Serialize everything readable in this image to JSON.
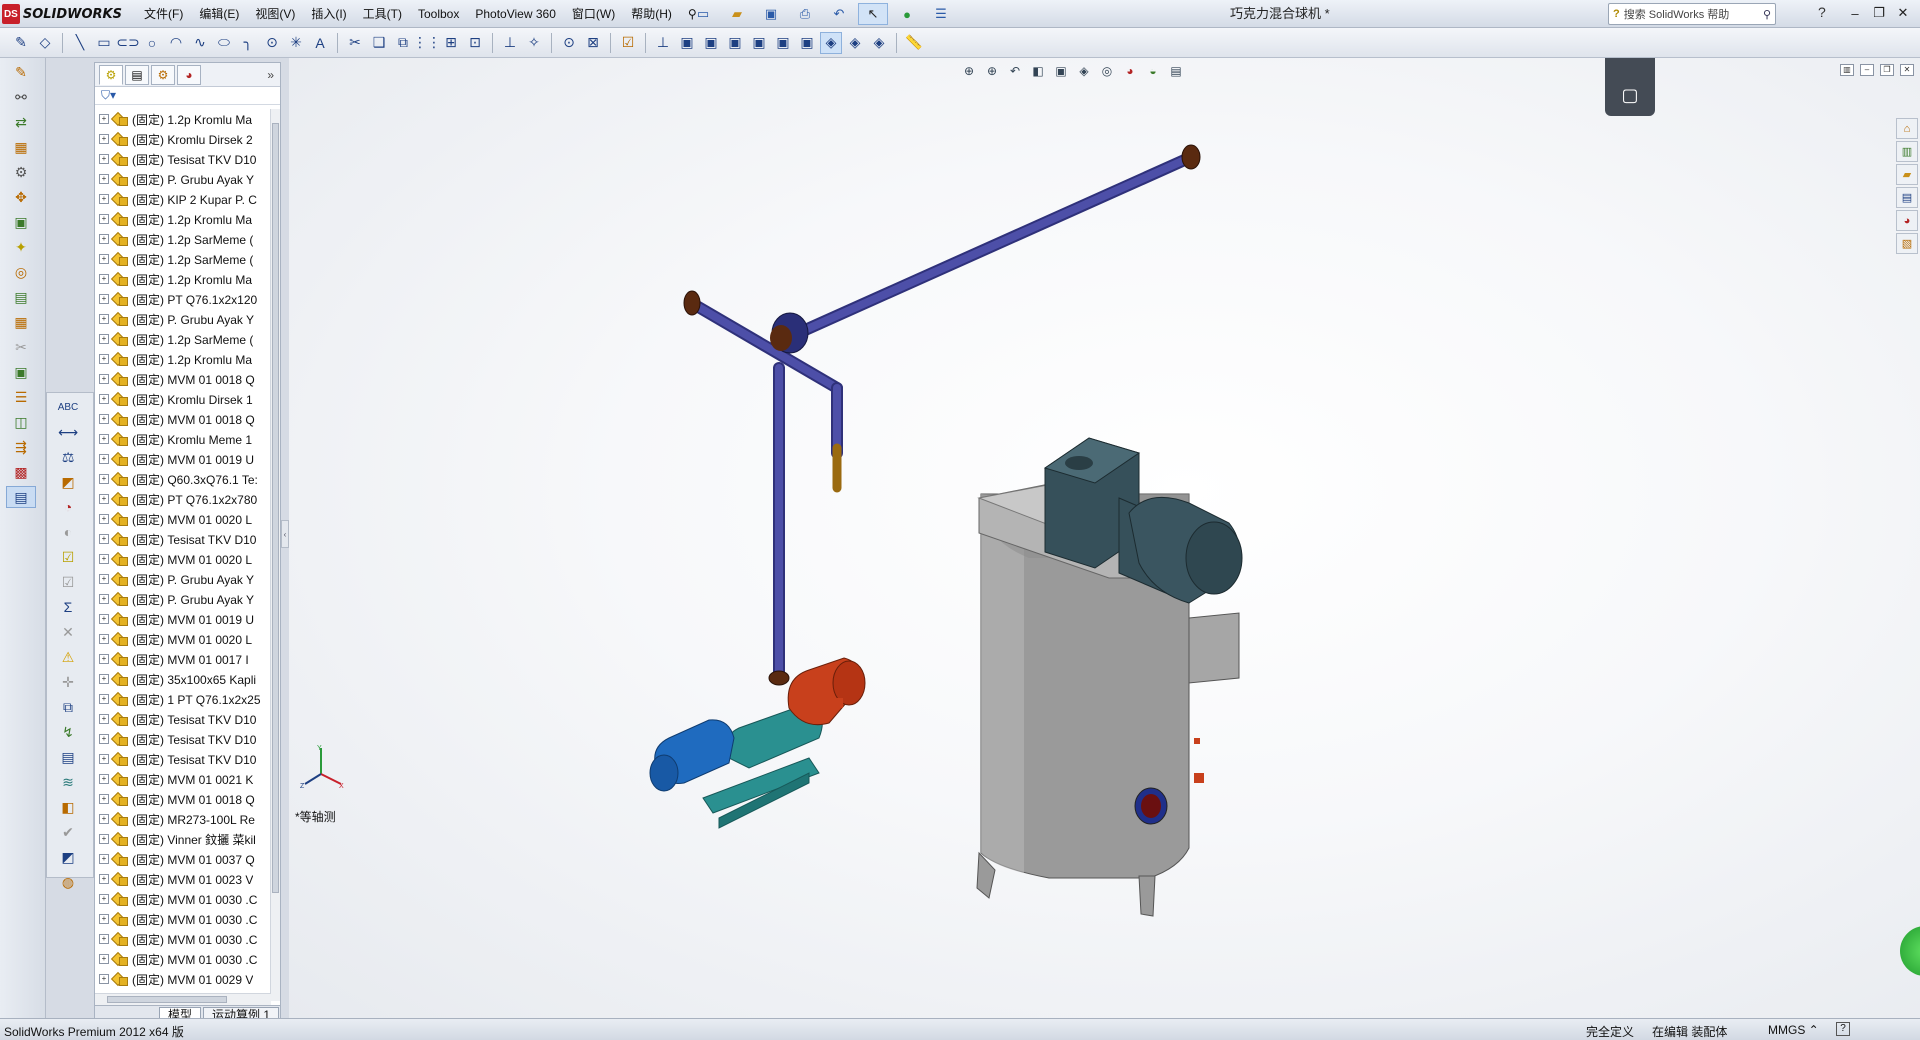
{
  "app": {
    "logo_ds": "DS",
    "logo_text": "SOLIDWORKS",
    "document_title": "巧克力混合球机 *",
    "search_placeholder": "搜索 SolidWorks 帮助"
  },
  "menu": [
    "文件(F)",
    "编辑(E)",
    "视图(V)",
    "插入(I)",
    "工具(T)",
    "Toolbox",
    "PhotoView 360",
    "窗口(W)",
    "帮助(H)"
  ],
  "tree": {
    "items": [
      "(固定) 1.2p Kromlu  Ma",
      "(固定) Kromlu  Dirsek 2",
      "(固定) Tesisat TKV D10",
      "(固定) P. Grubu Ayak Y",
      "(固定) KIP 2 Kupar P. C",
      "(固定) 1.2p Kromlu  Ma",
      "(固定) 1.2p SarMeme (",
      "(固定) 1.2p SarMeme (",
      "(固定) 1.2p Kromlu  Ma",
      "(固定) PT Q76.1x2x120",
      "(固定) P. Grubu Ayak Y",
      "(固定) 1.2p SarMeme (",
      "(固定) 1.2p Kromlu  Ma",
      "(固定) MVM 01 0018 Q",
      "(固定) Kromlu  Dirsek 1",
      "(固定) MVM 01 0018 Q",
      "(固定) Kromlu  Meme 1",
      "(固定) MVM 01 0019 U",
      "(固定) Q60.3xQ76.1 Te:",
      "(固定) PT Q76.1x2x780",
      "(固定) MVM 01 0020  L",
      "(固定) Tesisat TKV D10",
      "(固定) MVM 01 0020  L",
      "(固定) P. Grubu Ayak Y",
      "(固定) P. Grubu Ayak Y",
      "(固定) MVM 01 0019 U",
      "(固定) MVM 01 0020  L",
      "(固定) MVM 01 0017  I",
      "(固定) 35x100x65 Kapli",
      "(固定) 1 PT Q76.1x2x25",
      "(固定) Tesisat TKV D10",
      "(固定) Tesisat TKV D10",
      "(固定) Tesisat TKV D10",
      "(固定) MVM 01 0021 K",
      "(固定) MVM 01 0018 Q",
      "(固定) MR273-100L Re",
      "(固定) Vinner 鈫攦 菜kil",
      "(固定) MVM 01 0037 Q",
      "(固定) MVM 01 0023 V",
      "(固定) MVM 01 0030 .C",
      "(固定) MVM 01 0030 .C",
      "(固定) MVM 01 0030 .C",
      "(固定) MVM 01 0030 .C",
      "(固定) MVM 01 0029 V"
    ],
    "tabs": [
      "模型",
      "运动算例 1"
    ]
  },
  "viewport": {
    "view_label": "*等轴测",
    "triad_x": "X",
    "triad_y": "Y",
    "triad_z": "Z"
  },
  "status": {
    "left": "SolidWorks Premium 2012 x64 版",
    "state": "完全定义",
    "editing": "在编辑 装配体",
    "units": "MMGS ⌃",
    "help": "?"
  },
  "colors": {
    "pipe": "#4d4fa8",
    "tank": "#9a9a9a",
    "motor": "#36505a",
    "pump_body": "#c8401c",
    "pump_motor": "#1f6bbf",
    "base": "#2a9090"
  },
  "icons": {
    "menu_pin": "pushpin-icon",
    "search": "magnifier-icon"
  }
}
